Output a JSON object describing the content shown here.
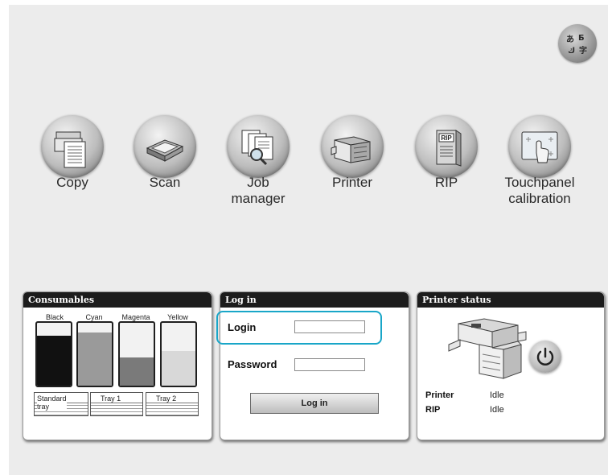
{
  "apps": [
    {
      "label": "Copy",
      "icon": "copy-icon"
    },
    {
      "label": "Scan",
      "icon": "scan-icon"
    },
    {
      "label": "Job\nmanager",
      "icon": "job-manager-icon"
    },
    {
      "label": "Printer",
      "icon": "printer-icon"
    },
    {
      "label": "RIP",
      "icon": "rip-icon",
      "icon_text": "RIP"
    },
    {
      "label": "Touchpanel\ncalibration",
      "icon": "touchpanel-calibration-icon"
    }
  ],
  "language_button": {
    "icon": "language-icon"
  },
  "consumables": {
    "title": "Consumables",
    "inks": [
      {
        "name": "Black",
        "level": 0.8,
        "color": "#111111"
      },
      {
        "name": "Cyan",
        "level": 0.85,
        "color": "#9a9a9a"
      },
      {
        "name": "Magenta",
        "level": 0.45,
        "color": "#7a7a7a"
      },
      {
        "name": "Yellow",
        "level": 0.55,
        "color": "#d8d8d8"
      }
    ],
    "trays": [
      {
        "name": "Standard\ntray",
        "level": 0.4
      },
      {
        "name": "Tray 1",
        "level": 0.7
      },
      {
        "name": "Tray 2",
        "level": 0.7
      }
    ]
  },
  "login": {
    "title": "Log in",
    "login_label": "Login",
    "login_value": "",
    "password_label": "Password",
    "password_value": "",
    "button_label": "Log in"
  },
  "printer_status": {
    "title": "Printer status",
    "rows": [
      {
        "key": "Printer",
        "value": "Idle"
      },
      {
        "key": "RIP",
        "value": "Idle"
      }
    ],
    "power_icon": "power-icon"
  },
  "colors": {
    "accent": "#19a6c8",
    "header": "#1c1c1c",
    "background": "#ececec"
  }
}
